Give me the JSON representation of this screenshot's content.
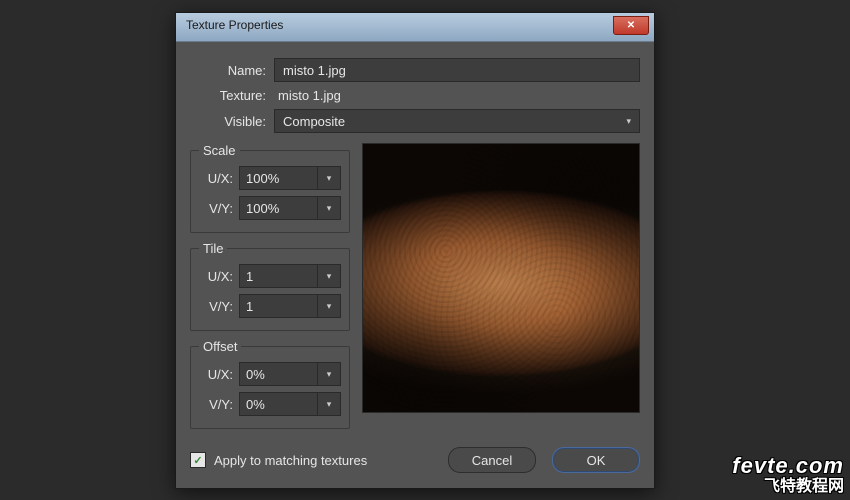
{
  "dialog": {
    "title": "Texture Properties",
    "labels": {
      "name": "Name:",
      "texture": "Texture:",
      "visible": "Visible:"
    },
    "values": {
      "name": "misto 1.jpg",
      "texture": "misto 1.jpg",
      "visible": "Composite"
    },
    "groups": {
      "scale": {
        "title": "Scale",
        "ux_label": "U/X:",
        "ux_value": "100%",
        "vy_label": "V/Y:",
        "vy_value": "100%"
      },
      "tile": {
        "title": "Tile",
        "ux_label": "U/X:",
        "ux_value": "1",
        "vy_label": "V/Y:",
        "vy_value": "1"
      },
      "offset": {
        "title": "Offset",
        "ux_label": "U/X:",
        "ux_value": "0%",
        "vy_label": "V/Y:",
        "vy_value": "0%"
      }
    },
    "checkbox": {
      "label": "Apply to matching textures",
      "checked": true
    },
    "buttons": {
      "cancel": "Cancel",
      "ok": "OK"
    }
  },
  "watermark": {
    "line1": "fevte.com",
    "line2": "飞特教程网"
  }
}
